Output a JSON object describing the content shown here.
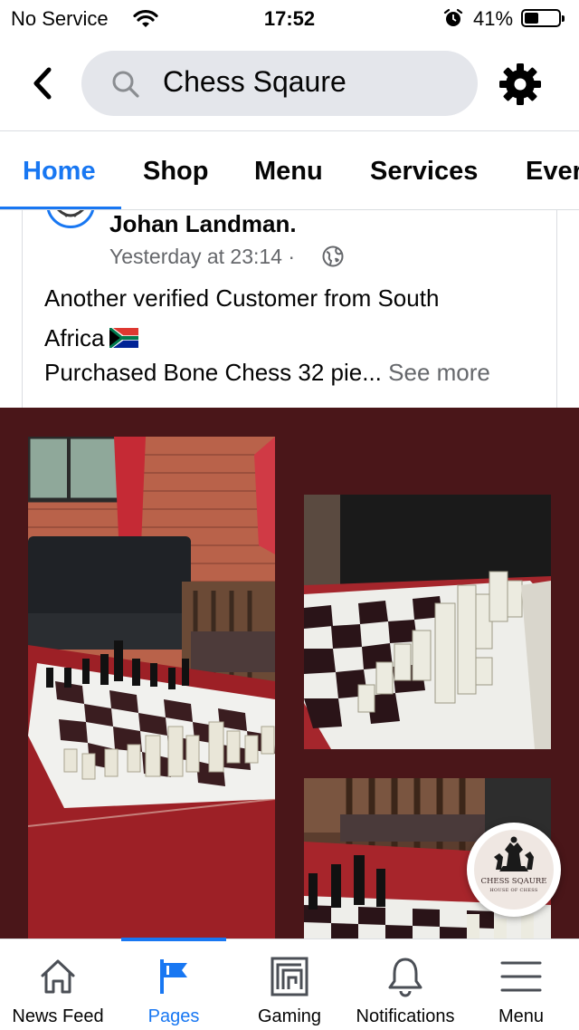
{
  "status_bar": {
    "carrier": "No Service",
    "time": "17:52",
    "battery_percent": "41%",
    "battery_level": 0.41
  },
  "search": {
    "query": "Chess Sqaure"
  },
  "tabs": [
    {
      "label": "Home",
      "active": true
    },
    {
      "label": "Shop",
      "active": false
    },
    {
      "label": "Menu",
      "active": false
    },
    {
      "label": "Services",
      "active": false
    },
    {
      "label": "Ever",
      "active": false
    }
  ],
  "post": {
    "author": "Johan Landman.",
    "timestamp": "Yesterday at 23:14 ·",
    "line1": "Another verified Customer from South",
    "line2": "Africa",
    "line3": "Purchased Bone Chess 32 pie...",
    "see_more": "See more"
  },
  "page_badge": {
    "brand": "CHESS SQAURE",
    "subtitle": "HOUSE OF CHESS"
  },
  "bottom_nav": [
    {
      "label": "News Feed",
      "icon": "home-icon",
      "active": false
    },
    {
      "label": "Pages",
      "icon": "flag-icon",
      "active": true
    },
    {
      "label": "Gaming",
      "icon": "gaming-icon",
      "active": false
    },
    {
      "label": "Notifications",
      "icon": "bell-icon",
      "active": false
    },
    {
      "label": "Menu",
      "icon": "menu-icon",
      "active": false
    }
  ],
  "colors": {
    "accent": "#1877f2",
    "photo_background": "#4a1619",
    "search_background": "#e4e6eb",
    "secondary_text": "#65676b"
  }
}
